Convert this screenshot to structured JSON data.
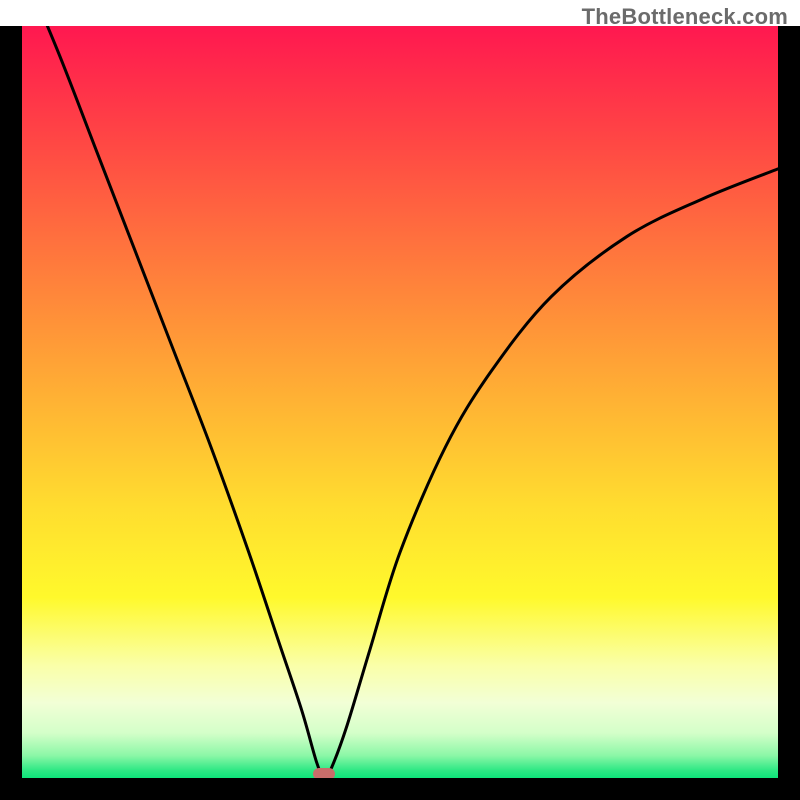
{
  "watermark": "TheBottleneck.com",
  "colors": {
    "curve": "#000000",
    "marker": "#c86d6a",
    "frame": "#000000"
  },
  "chart_data": {
    "type": "line",
    "title": "",
    "xlabel": "",
    "ylabel": "",
    "xlim": [
      0,
      1
    ],
    "ylim": [
      0,
      1
    ],
    "minimum": {
      "x": 0.4,
      "y": 0.0
    },
    "series": [
      {
        "name": "bottleneck-curve",
        "x": [
          0.0,
          0.05,
          0.1,
          0.15,
          0.2,
          0.25,
          0.3,
          0.34,
          0.37,
          0.39,
          0.4,
          0.41,
          0.43,
          0.46,
          0.5,
          0.56,
          0.62,
          0.7,
          0.8,
          0.9,
          1.0
        ],
        "y": [
          1.08,
          0.96,
          0.83,
          0.7,
          0.57,
          0.44,
          0.3,
          0.18,
          0.09,
          0.02,
          0.0,
          0.015,
          0.07,
          0.17,
          0.3,
          0.44,
          0.54,
          0.64,
          0.72,
          0.77,
          0.81
        ]
      }
    ],
    "annotations": [
      {
        "type": "marker",
        "x": 0.4,
        "y": 0.0,
        "shape": "pill",
        "color": "#c86d6a"
      }
    ]
  }
}
